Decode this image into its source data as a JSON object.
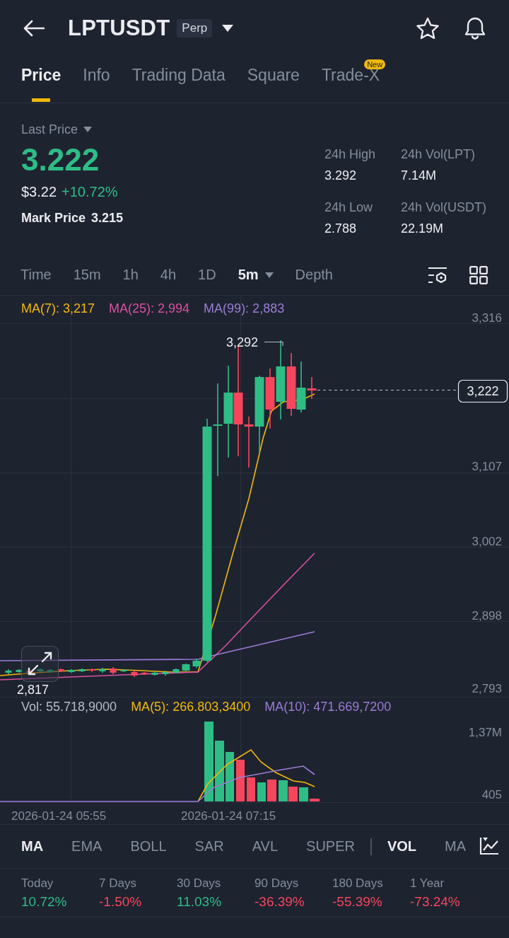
{
  "header": {
    "symbol": "LPTUSDT",
    "badge": "Perp"
  },
  "tabs": [
    {
      "label": "Price",
      "selected": true
    },
    {
      "label": "Info",
      "selected": false
    },
    {
      "label": "Trading Data",
      "selected": false
    },
    {
      "label": "Square",
      "selected": false
    },
    {
      "label": "Trade-X",
      "selected": false,
      "badge": "New"
    }
  ],
  "price": {
    "label": "Last Price",
    "last": "3.222",
    "rising": true,
    "usd": "$3.22",
    "change": "+10.72%",
    "mark_label": "Mark Price",
    "mark": "3.215"
  },
  "stats": [
    {
      "label": "24h High",
      "value": "3.292"
    },
    {
      "label": "24h Vol(LPT)",
      "value": "7.14M"
    },
    {
      "label": "24h Low",
      "value": "2.788"
    },
    {
      "label": "24h Vol(USDT)",
      "value": "22.19M"
    }
  ],
  "intervals": [
    {
      "label": "Time",
      "selected": false,
      "dropdown": false
    },
    {
      "label": "15m",
      "selected": false,
      "dropdown": false
    },
    {
      "label": "1h",
      "selected": false,
      "dropdown": false
    },
    {
      "label": "4h",
      "selected": false,
      "dropdown": false
    },
    {
      "label": "1D",
      "selected": false,
      "dropdown": false
    },
    {
      "label": "5m",
      "selected": true,
      "dropdown": true
    },
    {
      "label": "Depth",
      "selected": false,
      "dropdown": false
    }
  ],
  "chart": {
    "legend": [
      {
        "text": "MA(7): 3,217",
        "color": "#f0b90b"
      },
      {
        "text": "MA(25): 2,994",
        "color": "#d9519f"
      },
      {
        "text": "MA(99): 2,883",
        "color": "#9a7dd6"
      }
    ],
    "y_labels": [
      "3,316",
      "3,107",
      "3,002",
      "2,898",
      "2,793"
    ],
    "current_price": "3,222",
    "high_label": "3,292",
    "low_label": "2,817"
  },
  "volume": {
    "legend": [
      {
        "text": "Vol: 55.718,9000",
        "color": "#b7bdc6"
      },
      {
        "text": "MA(5): 266.803,3400",
        "color": "#f0b90b"
      },
      {
        "text": "MA(10): 471.669,7200",
        "color": "#9a7dd6"
      }
    ],
    "y_labels": [
      "1,37M",
      "405"
    ],
    "x_labels": [
      "2026-01-24 05:55",
      "2026-01-24 07:15"
    ]
  },
  "indicators": [
    {
      "label": "MA",
      "selected": true,
      "divider_before": false
    },
    {
      "label": "EMA",
      "selected": false,
      "divider_before": false
    },
    {
      "label": "BOLL",
      "selected": false,
      "divider_before": false
    },
    {
      "label": "SAR",
      "selected": false,
      "divider_before": false
    },
    {
      "label": "AVL",
      "selected": false,
      "divider_before": false
    },
    {
      "label": "SUPER",
      "selected": false,
      "divider_before": false
    },
    {
      "label": "VOL",
      "selected": true,
      "divider_before": true
    },
    {
      "label": "MA",
      "selected": false,
      "divider_before": false
    }
  ],
  "returns": [
    {
      "period": "Today",
      "value": "10.72%",
      "color": "#2ebd85"
    },
    {
      "period": "7 Days",
      "value": "-1.50%",
      "color": "#f6465d"
    },
    {
      "period": "30 Days",
      "value": "11.03%",
      "color": "#2ebd85"
    },
    {
      "period": "90 Days",
      "value": "-36.39%",
      "color": "#f6465d"
    },
    {
      "period": "180 Days",
      "value": "-55.39%",
      "color": "#f6465d"
    },
    {
      "period": "1 Year",
      "value": "-73.24%",
      "color": "#f6465d"
    }
  ]
}
